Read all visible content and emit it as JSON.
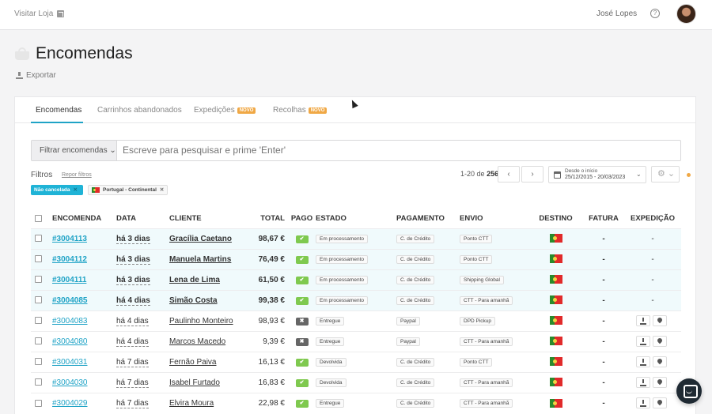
{
  "topbar": {
    "visit_store": "Visitar Loja",
    "user_name": "José Lopes"
  },
  "page": {
    "title": "Encomendas",
    "export_label": "Exportar"
  },
  "tabs": [
    {
      "label": "Encomendas",
      "badge": ""
    },
    {
      "label": "Carrinhos abandonados",
      "badge": ""
    },
    {
      "label": "Expedições",
      "badge": "NOVO"
    },
    {
      "label": "Recolhas",
      "badge": "NOVO"
    }
  ],
  "search": {
    "filter_button": "Filtrar encomendas",
    "placeholder": "Escreve para pesquisar e prime 'Enter'"
  },
  "filters": {
    "label": "Filtros",
    "reset": "Repor filtros",
    "tags": [
      "Não cancelada",
      "Portugal - Continental"
    ]
  },
  "pager": {
    "range": "1-20",
    "of": "de",
    "total": "256"
  },
  "date_range": {
    "line1": "Desde o início",
    "line2": "25/12/2015 - 20/03/2023"
  },
  "table": {
    "headers": {
      "order": "ENCOMENDA",
      "date": "DATA",
      "client": "CLIENTE",
      "total": "TOTAL",
      "paid": "PAGO",
      "state": "ESTADO",
      "payment": "PAGAMENTO",
      "shipping": "ENVIO",
      "destination": "DESTINO",
      "invoice": "FATURA",
      "dispatch": "EXPEDIÇÃO"
    },
    "rows": [
      {
        "id": "#3004113",
        "date": "há 3 dias",
        "client": "Gracília Caetano",
        "total": "98,67 €",
        "paid": true,
        "state": "Em processamento",
        "payment": "C. de Crédito",
        "shipping": "Ponto CTT",
        "invoice": "-",
        "dispatch": "-",
        "highlight": true
      },
      {
        "id": "#3004112",
        "date": "há 3 dias",
        "client": "Manuela Martins",
        "total": "76,49 €",
        "paid": true,
        "state": "Em processamento",
        "payment": "C. de Crédito",
        "shipping": "Ponto CTT",
        "invoice": "-",
        "dispatch": "-",
        "highlight": true
      },
      {
        "id": "#3004111",
        "date": "há 3 dias",
        "client": "Lena de Lima",
        "total": "61,50 €",
        "paid": true,
        "state": "Em processamento",
        "payment": "C. de Crédito",
        "shipping": "Shipping Global",
        "invoice": "-",
        "dispatch": "-",
        "highlight": true
      },
      {
        "id": "#3004085",
        "date": "há 4 dias",
        "client": "Simão Costa",
        "total": "99,38 €",
        "paid": true,
        "state": "Em processamento",
        "payment": "C. de Crédito",
        "shipping": "CTT - Para amanhã",
        "invoice": "-",
        "dispatch": "-",
        "highlight": true
      },
      {
        "id": "#3004083",
        "date": "há 4 dias",
        "client": "Paulinho Monteiro",
        "total": "98,93 €",
        "paid": false,
        "state": "Entregue",
        "payment": "Paypal",
        "shipping": "DPD Pickup",
        "invoice": "-",
        "dispatch": "",
        "highlight": false
      },
      {
        "id": "#3004080",
        "date": "há 4 dias",
        "client": "Marcos Macedo",
        "total": "9,39 €",
        "paid": false,
        "state": "Entregue",
        "payment": "Paypal",
        "shipping": "CTT - Para amanhã",
        "invoice": "-",
        "dispatch": "",
        "highlight": false
      },
      {
        "id": "#3004031",
        "date": "há 7 dias",
        "client": "Fernão Paiva",
        "total": "16,13 €",
        "paid": true,
        "state": "Devolvida",
        "payment": "C. de Crédito",
        "shipping": "Ponto CTT",
        "invoice": "-",
        "dispatch": "",
        "highlight": false
      },
      {
        "id": "#3004030",
        "date": "há 7 dias",
        "client": "Isabel Furtado",
        "total": "16,83 €",
        "paid": true,
        "state": "Devolvida",
        "payment": "C. de Crédito",
        "shipping": "CTT - Para amanhã",
        "invoice": "-",
        "dispatch": "",
        "highlight": false
      },
      {
        "id": "#3004029",
        "date": "há 7 dias",
        "client": "Elvira Moura",
        "total": "22,98 €",
        "paid": true,
        "state": "Entregue",
        "payment": "C. de Crédito",
        "shipping": "CTT - Para amanhã",
        "invoice": "-",
        "dispatch": "",
        "highlight": false
      }
    ]
  },
  "colors": {
    "accent": "#1fa3c6",
    "paid_yes": "#7fc94f",
    "paid_no": "#666666",
    "badge_new": "#f0a845"
  }
}
